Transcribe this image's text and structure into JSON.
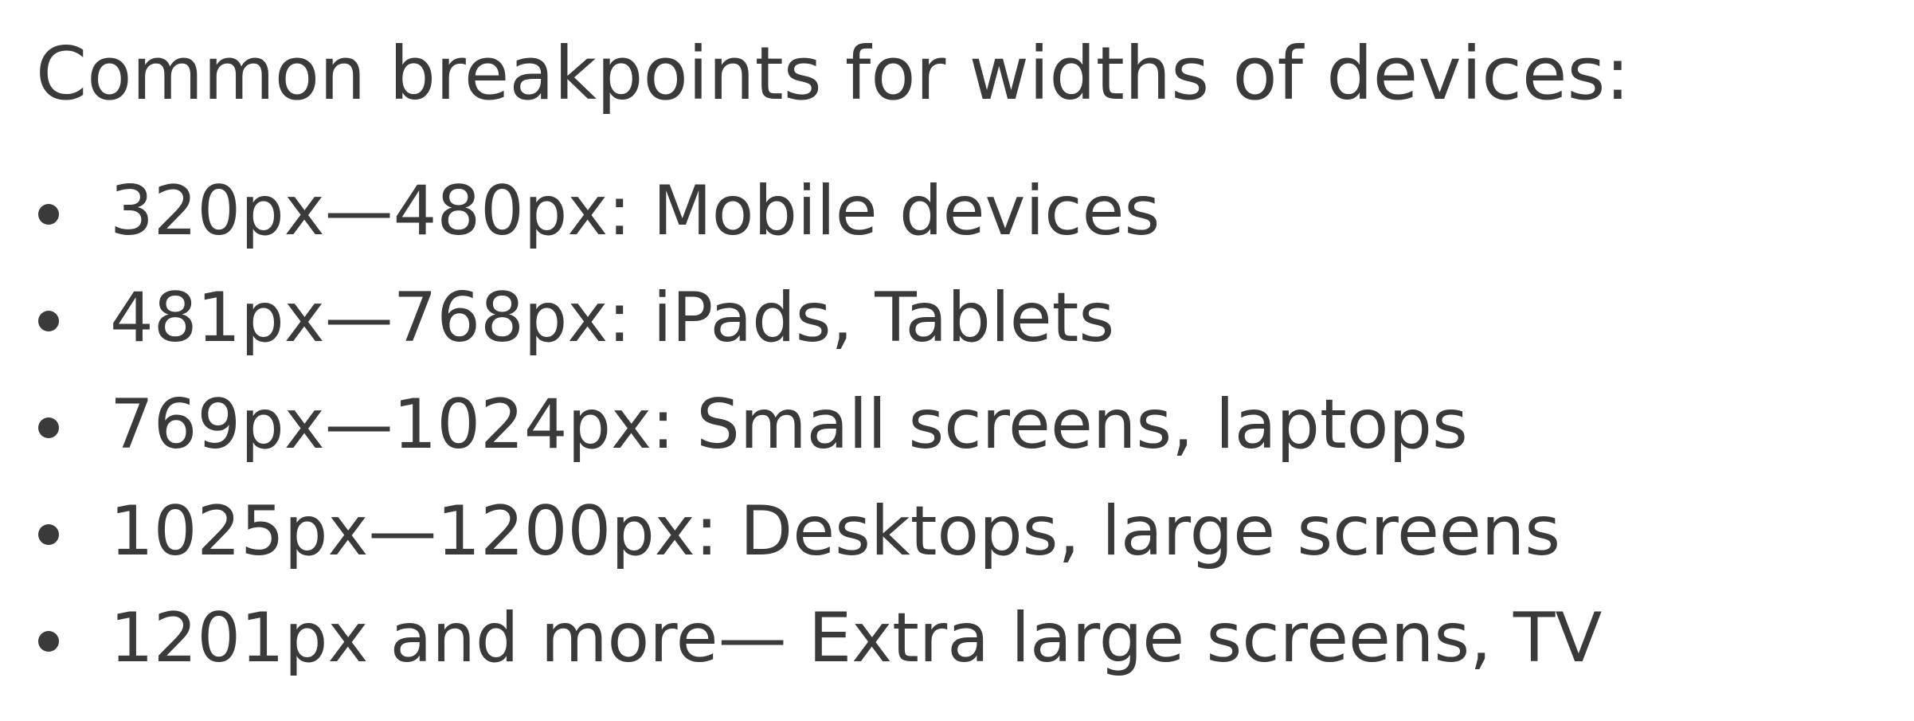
{
  "heading": "Common breakpoints for widths of devices:",
  "items": [
    {
      "icon": "bullet-icon",
      "text": "320px—480px: Mobile devices"
    },
    {
      "icon": "bullet-icon",
      "text": "481px—768px: iPads, Tablets"
    },
    {
      "icon": "bullet-icon",
      "text": "769px—1024px: Small screens, laptops"
    },
    {
      "icon": "bullet-icon",
      "text": "1025px—1200px: Desktops, large screens"
    },
    {
      "icon": "bullet-icon",
      "text": "1201px and more— Extra large screens, TV"
    }
  ]
}
